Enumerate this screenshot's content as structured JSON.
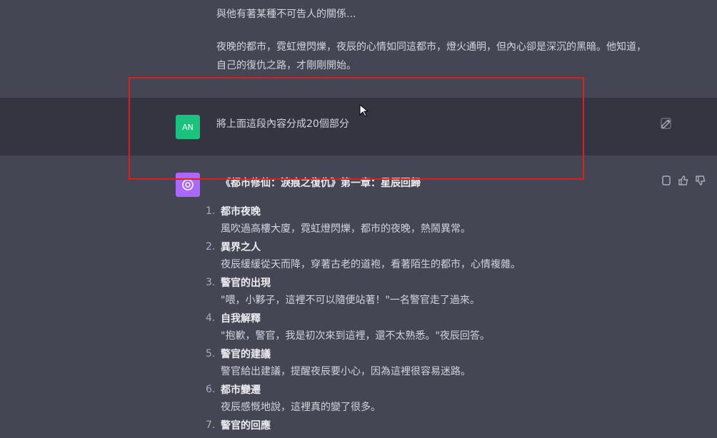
{
  "previous_message": {
    "partial_line": "與他有著某種不可告人的關係...",
    "paragraph": "夜晚的都市，霓虹燈閃爍，夜辰的心情如同這都市，燈火通明，但內心卻是深沉的黑暗。他知道，自己的復仇之路，才剛剛開始。"
  },
  "user_message": {
    "avatar_initials": "AN",
    "text": "將上面這段內容分成20個部分"
  },
  "assistant_message": {
    "title": "《都市修仙：淚痕之復仇》第一章：星辰回歸",
    "items": [
      {
        "num": "1.",
        "heading": "都市夜晚",
        "desc": "風吹過高樓大廈，霓虹燈閃爍，都市的夜晚，熱鬧異常。"
      },
      {
        "num": "2.",
        "heading": "異界之人",
        "desc": "夜辰緩緩從天而降，穿著古老的道袍，看著陌生的都市，心情複雜。"
      },
      {
        "num": "3.",
        "heading": "警官的出現",
        "desc": "\"喂，小夥子，這裡不可以隨便站著！\"一名警官走了過來。"
      },
      {
        "num": "4.",
        "heading": "自我解釋",
        "desc": "\"抱歉，警官，我是初次來到這裡，還不太熟悉。\"夜辰回答。"
      },
      {
        "num": "5.",
        "heading": "警官的建議",
        "desc": "警官給出建議，提醒夜辰要小心，因為這裡很容易迷路。"
      },
      {
        "num": "6.",
        "heading": "都市變遷",
        "desc": "夜辰感慨地說，這裡真的變了很多。"
      },
      {
        "num": "7.",
        "heading": "警官的回應",
        "desc": ""
      }
    ]
  },
  "colors": {
    "assistant_bg": "#444654",
    "user_bg": "#343541",
    "user_avatar": "#19c37d",
    "gpt_avatar": "#ab68ff",
    "highlight": "#e11d1d"
  }
}
